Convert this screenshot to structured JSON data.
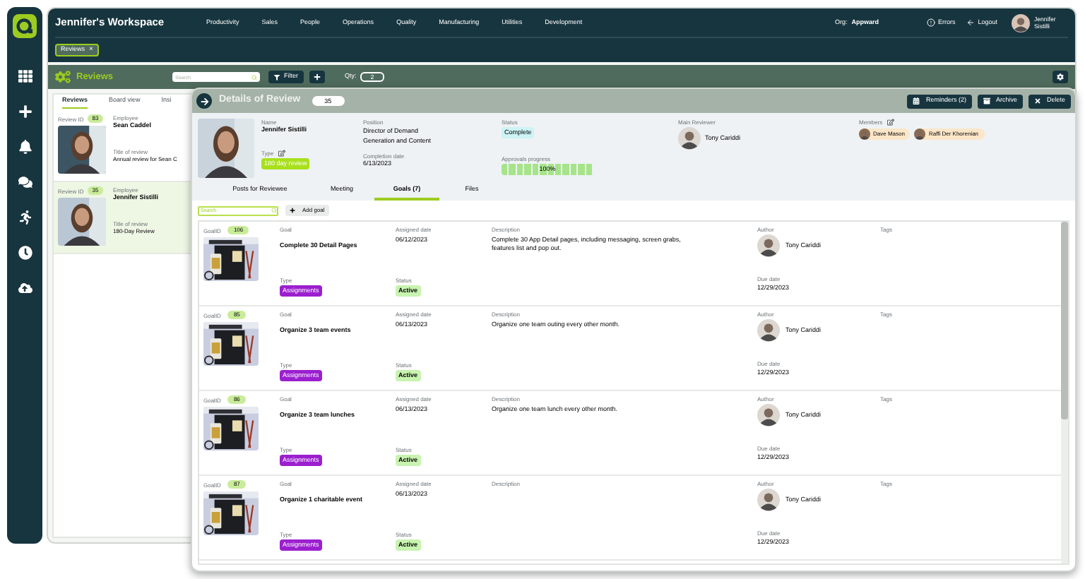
{
  "header": {
    "title": "Jennifer's Workspace",
    "nav": [
      "Productivity",
      "Sales",
      "People",
      "Operations",
      "Quality",
      "Manufacturing",
      "Utilities",
      "Development"
    ],
    "org_label": "Org:",
    "org": "Appward",
    "errors": "Errors",
    "logout": "Logout",
    "user": "Jennifer Sistilli"
  },
  "open_tabs": [
    {
      "label": "Reviews",
      "close": "×"
    }
  ],
  "toolbar": {
    "title": "Reviews",
    "search": {
      "placeholder": "Search"
    },
    "filter": "Filter",
    "qty_label": "Qty:",
    "qty": "2"
  },
  "list": {
    "tabs": [
      {
        "label": "Reviews",
        "selected": true
      },
      {
        "label": "Board view",
        "selected": false
      },
      {
        "label": "Insi",
        "selected": false
      }
    ],
    "reviews": [
      {
        "id_label": "Review ID",
        "id": "83",
        "employee_label": "Employee",
        "employee": "Sean Caddel",
        "title_label": "Title of review",
        "title": "Annual review for Sean C",
        "selected": false
      },
      {
        "id_label": "Review ID",
        "id": "35",
        "employee_label": "Employee",
        "employee": "Jennifer Sistilli",
        "title_label": "Title of review",
        "title": "180-Day Review",
        "selected": true
      }
    ]
  },
  "details": {
    "title": "Details of Review",
    "id": "35",
    "actions": [
      {
        "kind": "reminders",
        "label": "Reminders (2)"
      },
      {
        "kind": "archive",
        "label": "Archive"
      },
      {
        "kind": "delete",
        "label": "Delete"
      }
    ],
    "name_label": "Name",
    "name": "Jennifer Sistilli",
    "type_label": "Type",
    "type": "180 day review",
    "position_label": "Position",
    "position": "Director of Demand Generation and Content",
    "completion_label": "Completion date",
    "completion": "6/13/2023",
    "status_label": "Status",
    "status": "Complete",
    "approvals_label": "Approvals progress",
    "approvals": {
      "level": 1,
      "reading": "100%"
    },
    "reviewer_label": "Main Reviewer",
    "reviewer": "Tony Cariddi",
    "members_label": "Members",
    "members": [
      {
        "name": "Dave Mason"
      },
      {
        "name": "Raffi Der Khorenian"
      }
    ],
    "tabs": [
      {
        "label": "Posts for Reviewee",
        "selected": false
      },
      {
        "label": "Meeting",
        "selected": false
      },
      {
        "label": "Goals (7)",
        "selected": true
      },
      {
        "label": "Files",
        "selected": false
      }
    ],
    "search": {
      "placeholder": "Search"
    },
    "add_goal": "Add goal",
    "goals": [
      {
        "id_label": "GoalID",
        "id": "106",
        "goal_label": "Goal",
        "goal": "Complete 30 Detail Pages",
        "type_label": "Type",
        "type": "Assignments",
        "assigned_label": "Assigned date",
        "assigned": "06/12/2023",
        "status_label": "Status",
        "status": "Active",
        "description_label": "Description",
        "description": "Complete 30 App Detail pages, including messaging, screen grabs, features list and pop out.",
        "author_label": "Author",
        "author": "Tony Cariddi",
        "due_label": "Due date",
        "due": "12/29/2023",
        "tags_label": "Tags"
      },
      {
        "id_label": "GoalID",
        "id": "85",
        "goal_label": "Goal",
        "goal": "Organize 3 team events",
        "type_label": "Type",
        "type": "Assignments",
        "assigned_label": "Assigned date",
        "assigned": "06/13/2023",
        "status_label": "Status",
        "status": "Active",
        "description_label": "Description",
        "description": "Organize one team outing every other month.",
        "author_label": "Author",
        "author": "Tony Cariddi",
        "due_label": "Due date",
        "due": "12/29/2023",
        "tags_label": "Tags"
      },
      {
        "id_label": "GoalID",
        "id": "86",
        "goal_label": "Goal",
        "goal": "Organize 3 team lunches",
        "type_label": "Type",
        "type": "Assignments",
        "assigned_label": "Assigned date",
        "assigned": "06/13/2023",
        "status_label": "Status",
        "status": "Active",
        "description_label": "Description",
        "description": "Organize one team lunch every other month.",
        "author_label": "Author",
        "author": "Tony Cariddi",
        "due_label": "Due date",
        "due": "12/29/2023",
        "tags_label": "Tags"
      },
      {
        "id_label": "GoalID",
        "id": "87",
        "goal_label": "Goal",
        "goal": "Organize 1 charitable event",
        "type_label": "Type",
        "type": "Assignments",
        "assigned_label": "Assigned date",
        "assigned": "06/13/2023",
        "status_label": "Status",
        "status": "Active",
        "description_label": "Description",
        "author_label": "Author",
        "author": "Tony Cariddi",
        "due_label": "Due date",
        "due": "12/29/2023",
        "tags_label": "Tags"
      }
    ]
  }
}
